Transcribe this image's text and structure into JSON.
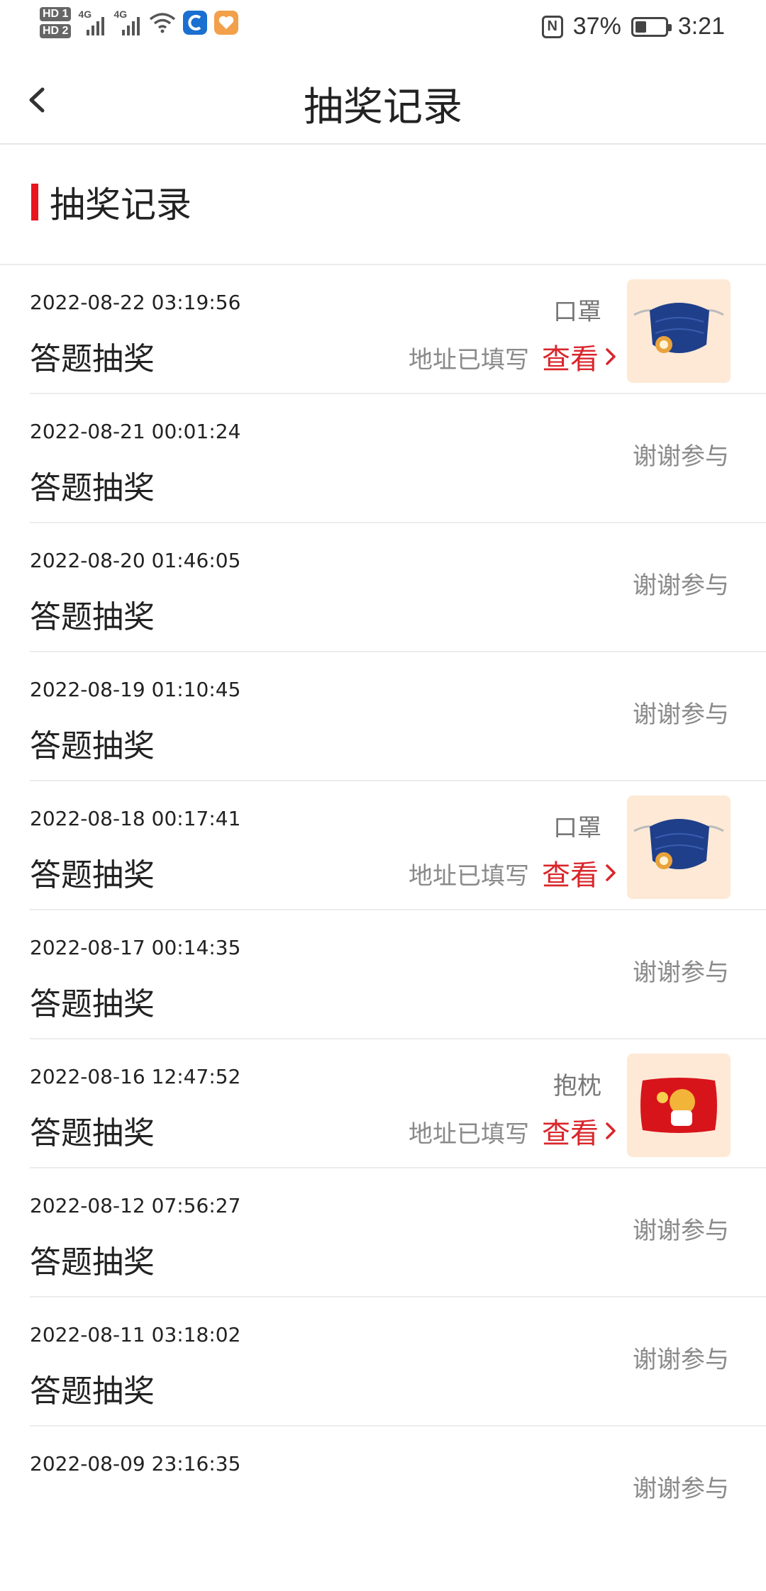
{
  "status_bar": {
    "hd1": "HD 1",
    "hd2": "HD 2",
    "net1": "4G",
    "net2": "4G",
    "nfc": "N",
    "battery_pct": "37%",
    "battery_level": 0.37,
    "time": "3:21"
  },
  "navbar": {
    "title": "抽奖记录",
    "back_icon": "chevron-left-icon"
  },
  "section": {
    "title": "抽奖记录"
  },
  "colors": {
    "accent": "#e8151d",
    "link": "#d9262b",
    "muted": "#8a8a8a"
  },
  "records": [
    {
      "time": "2022-08-22 03:19:56",
      "type": "答题抽奖",
      "won": true,
      "prize": "口罩",
      "address_status": "地址已填写",
      "view_label": "查看",
      "image": "mask-icon"
    },
    {
      "time": "2022-08-21 00:01:24",
      "type": "答题抽奖",
      "won": false,
      "result": "谢谢参与"
    },
    {
      "time": "2022-08-20 01:46:05",
      "type": "答题抽奖",
      "won": false,
      "result": "谢谢参与"
    },
    {
      "time": "2022-08-19 01:10:45",
      "type": "答题抽奖",
      "won": false,
      "result": "谢谢参与"
    },
    {
      "time": "2022-08-18 00:17:41",
      "type": "答题抽奖",
      "won": true,
      "prize": "口罩",
      "address_status": "地址已填写",
      "view_label": "查看",
      "image": "mask-icon"
    },
    {
      "time": "2022-08-17 00:14:35",
      "type": "答题抽奖",
      "won": false,
      "result": "谢谢参与"
    },
    {
      "time": "2022-08-16 12:47:52",
      "type": "答题抽奖",
      "won": true,
      "prize": "抱枕",
      "address_status": "地址已填写",
      "view_label": "查看",
      "image": "pillow-icon"
    },
    {
      "time": "2022-08-12 07:56:27",
      "type": "答题抽奖",
      "won": false,
      "result": "谢谢参与"
    },
    {
      "time": "2022-08-11 03:18:02",
      "type": "答题抽奖",
      "won": false,
      "result": "谢谢参与"
    },
    {
      "time": "2022-08-09 23:16:35",
      "type": "",
      "won": false,
      "result": "谢谢参与"
    }
  ]
}
